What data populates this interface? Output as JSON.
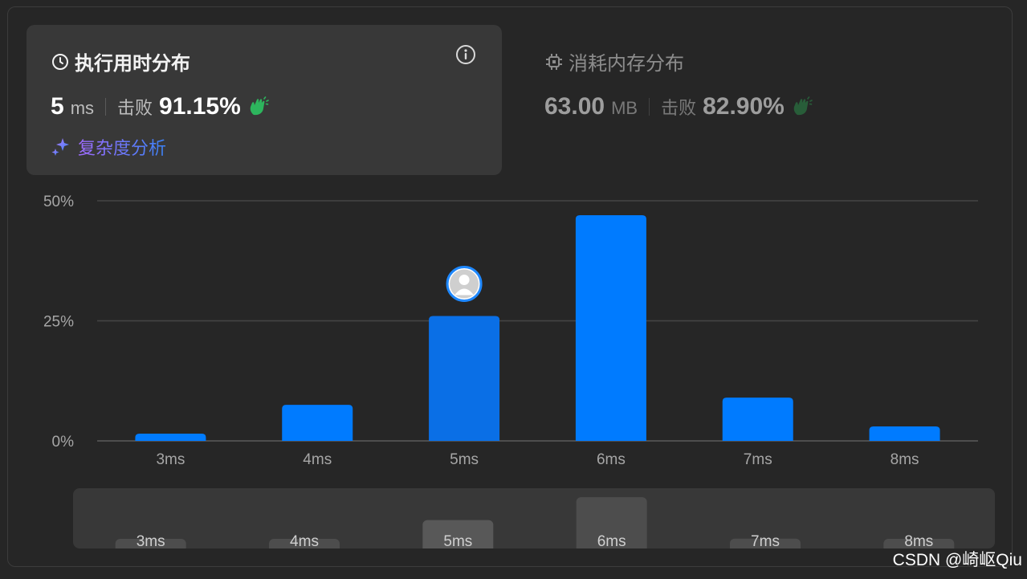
{
  "runtime": {
    "title": "执行用时分布",
    "value": "5",
    "unit": "ms",
    "beat_label": "击败",
    "beat_pct": "91.15%",
    "analysis_label": "复杂度分析"
  },
  "memory": {
    "title": "消耗内存分布",
    "value": "63.00",
    "unit": "MB",
    "beat_label": "击败",
    "beat_pct": "82.90%"
  },
  "icons": {
    "clock": "clock-icon",
    "info": "info-icon",
    "clap": "clap-icon",
    "sparkle": "sparkle-icon",
    "chip": "chip-icon",
    "avatar": "avatar-icon"
  },
  "colors": {
    "bar": "#007bff",
    "bar_selected": "#0a6fe6",
    "clap_runtime": "#2db55d",
    "clap_memory": "#2a8a4a",
    "analysis_gradient_start": "#a06cff",
    "analysis_gradient_end": "#3b82f6"
  },
  "chart_data": {
    "type": "bar",
    "categories": [
      "3ms",
      "4ms",
      "5ms",
      "6ms",
      "7ms",
      "8ms"
    ],
    "values": [
      1.5,
      7.5,
      26,
      47,
      9,
      3
    ],
    "ylim": [
      0,
      50
    ],
    "yticks": [
      "0%",
      "25%",
      "50%"
    ],
    "selected": "5ms",
    "grid": true
  },
  "overview": {
    "categories": [
      "3ms",
      "4ms",
      "5ms",
      "6ms",
      "7ms",
      "8ms"
    ],
    "values": [
      1.5,
      7.5,
      26,
      47,
      9,
      3
    ]
  },
  "watermark": "CSDN @崎岖Qiu"
}
